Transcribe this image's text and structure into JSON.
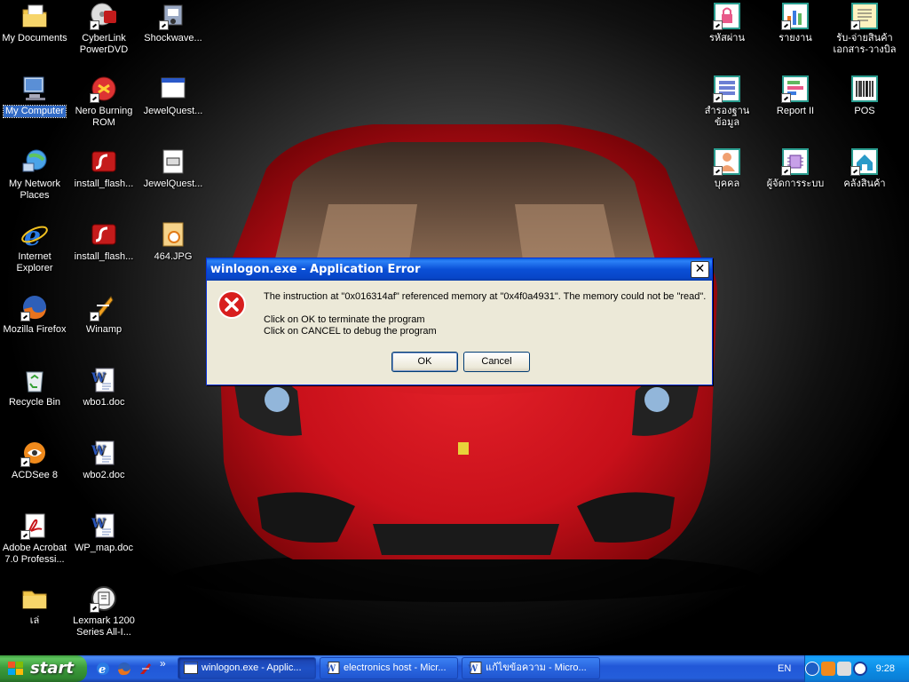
{
  "desktop": {
    "left_icons": [
      {
        "label": "My Documents",
        "icon": "folder-documents-icon"
      },
      {
        "label": "CyberLink PowerDVD",
        "icon": "powerdvd-icon"
      },
      {
        "label": "Shockwave...",
        "icon": "shockwave-icon"
      },
      {
        "label": "My Computer",
        "icon": "computer-icon",
        "selected": true
      },
      {
        "label": "Nero Burning ROM",
        "icon": "nero-icon"
      },
      {
        "label": "JewelQuest...",
        "icon": "window-icon"
      },
      {
        "label": "My Network Places",
        "icon": "network-icon"
      },
      {
        "label": "install_flash...",
        "icon": "flash-installer-icon"
      },
      {
        "label": "JewelQuest...",
        "icon": "exe-icon"
      },
      {
        "label": "Internet Explorer",
        "icon": "ie-icon"
      },
      {
        "label": "install_flash...",
        "icon": "flash-installer-icon"
      },
      {
        "label": "464.JPG",
        "icon": "jpg-icon"
      },
      {
        "label": "Mozilla Firefox",
        "icon": "firefox-icon"
      },
      {
        "label": "Winamp",
        "icon": "winamp-icon"
      },
      {
        "label": "Recycle Bin",
        "icon": "recycle-bin-icon"
      },
      {
        "label": "wbo1.doc",
        "icon": "word-doc-icon"
      },
      {
        "label": "ACDSee 8",
        "icon": "acdsee-icon"
      },
      {
        "label": "wbo2.doc",
        "icon": "word-doc-icon"
      },
      {
        "label": "Adobe Acrobat 7.0 Professi...",
        "icon": "acrobat-icon"
      },
      {
        "label": "WP_map.doc",
        "icon": "word-doc-icon"
      },
      {
        "label": "เล่",
        "icon": "folder-icon"
      },
      {
        "label": "Lexmark 1200 Series All-I...",
        "icon": "lexmark-icon"
      }
    ],
    "right_icons": [
      {
        "label": "รหัสผ่าน",
        "icon": "password-icon"
      },
      {
        "label": "รายงาน",
        "icon": "report-chart-icon"
      },
      {
        "label": "รับ-จ่ายสินค้า เอกสาร-วางบิล",
        "icon": "document-icon"
      },
      {
        "label": "สำรองฐาน ข้อมูล",
        "icon": "backup-list-icon"
      },
      {
        "label": "Report II",
        "icon": "report-icon"
      },
      {
        "label": "POS",
        "icon": "barcode-icon"
      },
      {
        "label": "บุคคล",
        "icon": "person-icon"
      },
      {
        "label": "ผู้จัดการระบบ",
        "icon": "admin-chip-icon"
      },
      {
        "label": "คลังสินค้า",
        "icon": "warehouse-home-icon"
      }
    ]
  },
  "dialog": {
    "title": "winlogon.exe - Application Error",
    "close": "✕",
    "line1": "The instruction at \"0x016314af\" referenced memory at \"0x4f0a4931\". The memory could not be \"read\".",
    "line2": "Click on OK to terminate the program",
    "line3": "Click on CANCEL to debug the program",
    "ok": "OK",
    "cancel": "Cancel"
  },
  "taskbar": {
    "start": "start",
    "chevron": "»",
    "buttons": [
      {
        "label": "winlogon.exe - Applic...",
        "active": true
      },
      {
        "label": "electronics host - Micr...",
        "active": false
      },
      {
        "label": "แก้ไขข้อความ - Micro...",
        "active": false
      }
    ],
    "language": "EN",
    "clock": "9:28"
  },
  "colors": {
    "accent": "#0a4fd6",
    "start_green": "#3c9b3c",
    "tray_blue": "#0c8de6",
    "error_red": "#d81e1e",
    "car_red": "#c8101a"
  }
}
